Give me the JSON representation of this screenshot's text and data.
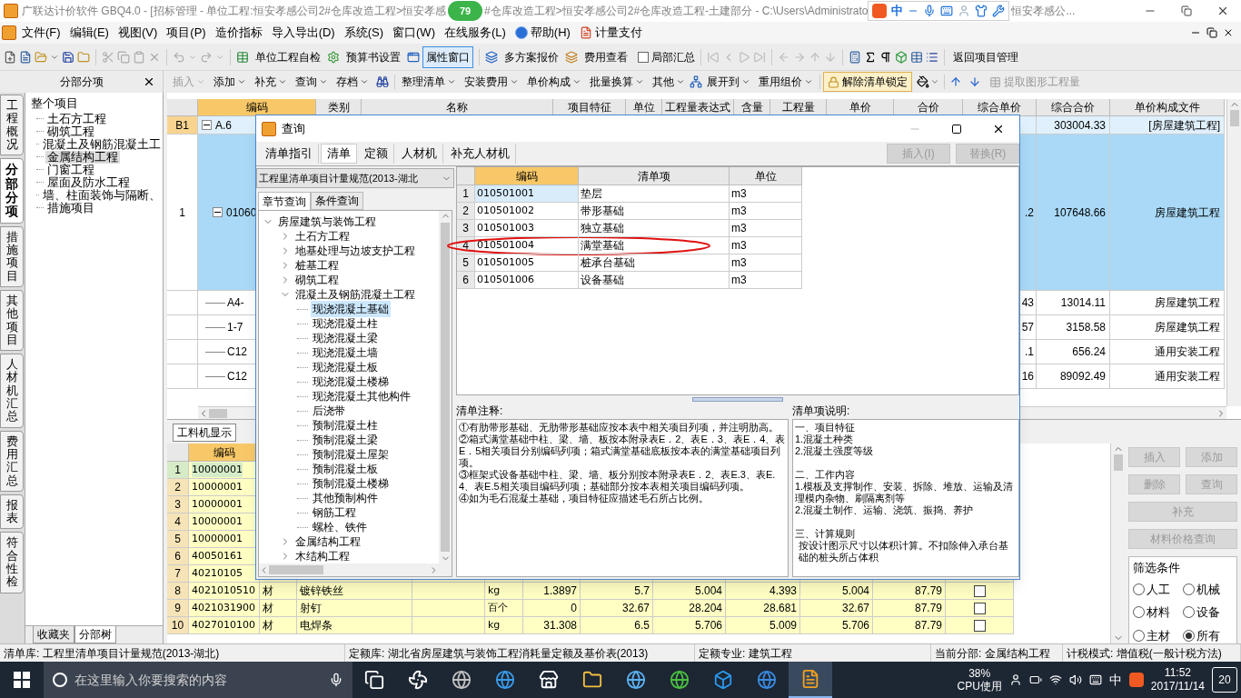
{
  "title_bar": {
    "title_parts": [
      "广联达计价软件 GBQ4.0 - [招标管理 - 单位工程:恒安孝感公司2#仓库改造工程>恒安孝感",
      "#仓库改造工程>恒安孝感公司2#仓库改造工程-土建部分 - C:\\Users\\Administrato",
      "恒安孝感公..."
    ],
    "badge": "79",
    "ime_mode": "中"
  },
  "menu": [
    {
      "label": "文件(F)",
      "kind": "plain"
    },
    {
      "label": "编辑(E)",
      "kind": "plain"
    },
    {
      "label": "视图(V)",
      "kind": "plain"
    },
    {
      "label": "项目(P)",
      "kind": "plain"
    },
    {
      "label": "造价指标",
      "kind": "plain"
    },
    {
      "label": "导入导出(D)",
      "kind": "plain"
    },
    {
      "label": "系统(S)",
      "kind": "plain"
    },
    {
      "label": "窗口(W)",
      "kind": "plain"
    },
    {
      "label": "在线服务(L)",
      "kind": "plain"
    },
    {
      "label": "帮助(H)",
      "kind": "help"
    },
    {
      "label": "计量支付",
      "kind": "app"
    }
  ],
  "toolbar": {
    "buttons": [
      {
        "label": "单位工程自检",
        "selected": false
      },
      {
        "label": "预算书设置",
        "selected": false
      },
      {
        "label": "属性窗口",
        "selected": true
      },
      {
        "label": "多方案报价",
        "selected": false
      },
      {
        "label": "费用查看",
        "selected": false
      }
    ],
    "local_summary": {
      "label": "局部汇总",
      "checked": false
    },
    "return_button": "返回项目管理"
  },
  "edit_toolbar": {
    "pane_title": "分部分项",
    "edit_menus": [
      {
        "label": "插入",
        "disabled": true
      },
      {
        "label": "添加",
        "disabled": false
      },
      {
        "label": "补充",
        "disabled": false
      },
      {
        "label": "查询",
        "disabled": false
      },
      {
        "label": "存档",
        "disabled": false
      }
    ],
    "list_menus": [
      {
        "label": "整理清单",
        "disabled": false
      },
      {
        "label": "安装费用",
        "disabled": false
      },
      {
        "label": "单价构成",
        "disabled": false
      },
      {
        "label": "批量换算",
        "disabled": false
      },
      {
        "label": "其他",
        "disabled": false
      },
      {
        "label": "展开到",
        "disabled": false
      },
      {
        "label": "重用组价",
        "disabled": false
      }
    ],
    "lock_button": {
      "label": "解除清单锁定",
      "selected": true
    },
    "extract_button": {
      "label": "提取图形工程量",
      "disabled": true
    }
  },
  "side_tabs": [
    {
      "label": "工程概况",
      "selected": false
    },
    {
      "label": "分部分项",
      "selected": true
    },
    {
      "label": "措施项目",
      "selected": false
    },
    {
      "label": "其他项目",
      "selected": false
    },
    {
      "label": "人材机汇总",
      "selected": false
    },
    {
      "label": "费用汇总",
      "selected": false
    },
    {
      "label": "报表",
      "selected": false
    },
    {
      "label": "符合性检",
      "selected": false
    }
  ],
  "project_tree": {
    "label": "整个项目",
    "selected": false,
    "children": [
      {
        "label": "土石方工程",
        "selected": false
      },
      {
        "label": "砌筑工程",
        "selected": false
      },
      {
        "label": "混凝土及钢筋混凝土工",
        "selected": false
      },
      {
        "label": "金属结构工程",
        "selected": true
      },
      {
        "label": "门窗工程",
        "selected": false
      },
      {
        "label": "屋面及防水工程",
        "selected": false
      },
      {
        "label": "墙、柱面装饰与隔断、",
        "selected": false
      },
      {
        "label": "措施项目",
        "selected": false
      }
    ]
  },
  "tree_tabs": [
    {
      "label": "收藏夹",
      "selected": false
    },
    {
      "label": "分部树",
      "selected": true
    }
  ],
  "table": {
    "columns": [
      "编码",
      "类别",
      "名称",
      "项目特征",
      "单位",
      "工程量表达式",
      "含量",
      "工程量",
      "单价",
      "合价",
      "综合单价",
      "综合合价",
      "单价构成文件"
    ],
    "rows": [
      {
        "kind": "section",
        "header": "B1",
        "code": "A.6",
        "expanded": true,
        "total": "303004.33",
        "template": "[房屋建筑工程]",
        "selected": false
      },
      {
        "kind": "item",
        "header": "1",
        "code": "01060",
        "expanded": true,
        "unit_total": ".2",
        "total": "107648.66",
        "template": "房屋建筑工程",
        "selected": true
      },
      {
        "kind": "sub",
        "code": "A4-",
        "unit_total": "43",
        "total": "13014.11",
        "template": "房屋建筑工程",
        "selected": false
      },
      {
        "kind": "sub",
        "code": "1-7",
        "unit_total": "57",
        "total": "3158.58",
        "template": "房屋建筑工程",
        "selected": false
      },
      {
        "kind": "sub",
        "code": "C12",
        "unit_total": ".1",
        "total": "656.24",
        "template": "通用安装工程",
        "selected": false
      },
      {
        "kind": "sub",
        "code": "C12",
        "unit_total": "16",
        "total": "89092.49",
        "template": "通用安装工程",
        "selected": false
      }
    ]
  },
  "resource_panel": {
    "tab": "工料机显示",
    "code_column": "编码",
    "rows": [
      {
        "index": "1",
        "cells": [
          "10000001"
        ],
        "selected": true
      },
      {
        "index": "2",
        "cells": [
          "10000001"
        ],
        "selected": false
      },
      {
        "index": "3",
        "cells": [
          "10000001"
        ],
        "selected": false
      },
      {
        "index": "4",
        "cells": [
          "10000001"
        ],
        "selected": false
      },
      {
        "index": "5",
        "cells": [
          "10000001"
        ],
        "selected": false
      },
      {
        "index": "6",
        "cells": [
          "40050161"
        ],
        "selected": false
      },
      {
        "index": "7",
        "cells": [
          "40210105"
        ],
        "selected": false
      },
      {
        "index": "8",
        "cells": [
          "4021010510",
          "材",
          "镀锌铁丝",
          "kg",
          "1.3897",
          "5.7",
          "5.004",
          "4.393",
          "5.004",
          "87.79"
        ],
        "checked": false,
        "selected": false
      },
      {
        "index": "9",
        "cells": [
          "4021031900",
          "材",
          "射钉",
          "百个",
          "0",
          "32.67",
          "28.204",
          "28.681",
          "32.67",
          "87.79"
        ],
        "checked": false,
        "selected": false
      },
      {
        "index": "10",
        "cells": [
          "4027010100",
          "材",
          "电焊条",
          "kg",
          "31.308",
          "6.5",
          "5.706",
          "5.009",
          "5.706",
          "87.79"
        ],
        "checked": false,
        "selected": false
      }
    ],
    "buttons": [
      {
        "label": "插入",
        "disabled": true
      },
      {
        "label": "添加",
        "disabled": true
      },
      {
        "label": "删除",
        "disabled": true
      },
      {
        "label": "查询",
        "disabled": true
      },
      {
        "label": "补充",
        "disabled": true
      },
      {
        "label": "材料价格查询",
        "disabled": true
      }
    ],
    "filter": {
      "title": "筛选条件",
      "options": [
        {
          "label": "人工",
          "selected": false
        },
        {
          "label": "机械",
          "selected": false
        },
        {
          "label": "材料",
          "selected": false
        },
        {
          "label": "设备",
          "selected": false
        },
        {
          "label": "主材",
          "selected": false
        },
        {
          "label": "所有",
          "selected": true
        }
      ]
    }
  },
  "dialog": {
    "title": "查询",
    "tabs": [
      {
        "label": "清单指引",
        "selected": false
      },
      {
        "label": "清单",
        "selected": true
      },
      {
        "label": "定额",
        "selected": false
      },
      {
        "label": "人材机",
        "selected": false
      },
      {
        "label": "补充人材机",
        "selected": false
      }
    ],
    "actions": [
      {
        "label": "插入(I)",
        "disabled": true
      },
      {
        "label": "替换(R)",
        "disabled": true
      }
    ],
    "library": "工程里清单项目计量规范(2013-湖北",
    "subtabs": [
      {
        "label": "章节查询",
        "selected": true
      },
      {
        "label": "条件查询",
        "selected": false
      }
    ],
    "tree": {
      "label": "房屋建筑与装饰工程",
      "expanded": true,
      "selected": false,
      "children": [
        {
          "label": "土石方工程",
          "expanded": false,
          "selected": false
        },
        {
          "label": "地基处理与边坡支护工程",
          "expanded": false,
          "selected": false
        },
        {
          "label": "桩基工程",
          "expanded": false,
          "selected": false
        },
        {
          "label": "砌筑工程",
          "expanded": false,
          "selected": false
        },
        {
          "label": "混凝土及钢筋混凝土工程",
          "expanded": true,
          "selected": false,
          "children": [
            {
              "label": "现浇混凝土基础",
              "selected": true
            },
            {
              "label": "现浇混凝土柱",
              "selected": false
            },
            {
              "label": "现浇混凝土梁",
              "selected": false
            },
            {
              "label": "现浇混凝土墙",
              "selected": false
            },
            {
              "label": "现浇混凝土板",
              "selected": false
            },
            {
              "label": "现浇混凝土楼梯",
              "selected": false
            },
            {
              "label": "现浇混凝土其他构件",
              "selected": false
            },
            {
              "label": "后浇带",
              "selected": false
            },
            {
              "label": "预制混凝土柱",
              "selected": false
            },
            {
              "label": "预制混凝土梁",
              "selected": false
            },
            {
              "label": "预制混凝土屋架",
              "selected": false
            },
            {
              "label": "预制混凝土板",
              "selected": false
            },
            {
              "label": "预制混凝土楼梯",
              "selected": false
            },
            {
              "label": "其他预制构件",
              "selected": false
            },
            {
              "label": "钢筋工程",
              "selected": false
            },
            {
              "label": "螺栓、铁件",
              "selected": false
            }
          ]
        },
        {
          "label": "金属结构工程",
          "expanded": false,
          "selected": false
        },
        {
          "label": "木结构工程",
          "expanded": false,
          "selected": false
        }
      ]
    },
    "list": {
      "columns": [
        "编码",
        "清单项",
        "单位"
      ],
      "rows": [
        {
          "index": "1",
          "code": "010501001",
          "name": "垫层",
          "unit": "m3",
          "selected": true,
          "circled": false
        },
        {
          "index": "2",
          "code": "010501002",
          "name": "带形基础",
          "unit": "m3",
          "selected": false,
          "circled": false
        },
        {
          "index": "3",
          "code": "010501003",
          "name": "独立基础",
          "unit": "m3",
          "selected": false,
          "circled": false
        },
        {
          "index": "4",
          "code": "010501004",
          "name": "满堂基础",
          "unit": "m3",
          "selected": false,
          "circled": true
        },
        {
          "index": "5",
          "code": "010501005",
          "name": "桩承台基础",
          "unit": "m3",
          "selected": false,
          "circled": false
        },
        {
          "index": "6",
          "code": "010501006",
          "name": "设备基础",
          "unit": "m3",
          "selected": false,
          "circled": false
        }
      ]
    },
    "notes": {
      "title": "清单注释:",
      "paragraphs": [
        "①有肋带形基础、无肋带形基础应按本表中相关项目列项，并注明肋高。",
        "②箱式满堂基础中柱、梁、墙、板按本附录表E．2、表E．3、表E．4、表E．5相关项目分别编码列项；箱式满堂基础底板按本表的满堂基础项目列项。",
        "③框架式设备基础中柱、梁、墙、板分别按本附录表E．2、表E.3、表E.4、表E.5相关项目编码列项；基础部分按本表相关项目编码列项。",
        "④如为毛石混凝土基础，项目特征应描述毛石所占比例。"
      ]
    },
    "description": {
      "title": "清单项说明:",
      "sections": [
        {
          "heading": "一、项目特征",
          "lines": [
            "1.混凝土种类",
            "2.混凝土强度等级"
          ]
        },
        {
          "heading": "二、工作内容",
          "lines": [
            "1.模板及支撑制作、安装、拆除、堆放、运输及清理模内杂物、刷隔离剂等",
            "2.混凝土制作、运输、浇筑、振捣、养护"
          ]
        },
        {
          "heading": "三、计算规则",
          "lines": [
            "按设计图示尺寸以体积计算。不扣除伸入承台基础的桩头所占体积"
          ]
        }
      ]
    }
  },
  "status_bar": [
    "清单库: 工程里清单项目计量规范(2013-湖北)",
    "定额库: 湖北省房屋建筑与装饰工程消耗量定额及基价表(2013)",
    "定额专业: 建筑工程",
    "当前分部: 金属结构工程",
    "计税模式: 增值税(一般计税方法)"
  ],
  "taskbar": {
    "search_placeholder": "在这里输入你要搜索的内容",
    "cpu_value": "38%",
    "cpu_label": "CPU使用",
    "ime": "中",
    "time": "11:52",
    "date": "2017/11/14",
    "notifications": "20"
  }
}
